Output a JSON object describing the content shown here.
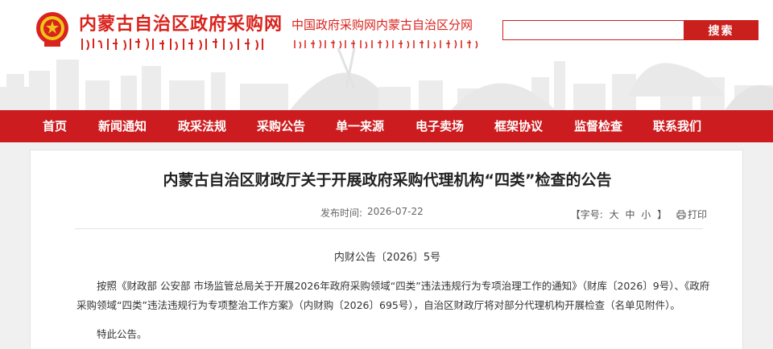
{
  "header": {
    "site_title": "内蒙古自治区政府采购网",
    "site_subtitle": "中国政府采购网内蒙古自治区分网",
    "search": {
      "value": "",
      "placeholder": "",
      "button_label": "搜索"
    }
  },
  "nav": {
    "items": [
      {
        "label": "首页"
      },
      {
        "label": "新闻通知"
      },
      {
        "label": "政采法规"
      },
      {
        "label": "采购公告"
      },
      {
        "label": "单一来源"
      },
      {
        "label": "电子卖场"
      },
      {
        "label": "框架协议"
      },
      {
        "label": "监督检查"
      },
      {
        "label": "联系我们"
      }
    ]
  },
  "article": {
    "title": "内蒙古自治区财政厅关于开展政府采购代理机构“四类”检查的公告",
    "publish_label": "发布时间:",
    "publish_date": "2026-07-22",
    "font_size_label": "【字号:",
    "size_large": "大",
    "size_medium": "中",
    "size_small": "小",
    "font_size_close": "】",
    "print_label": "打印",
    "doc_number": "内财公告〔2026〕5号",
    "body": "按照《财政部 公安部 市场监管总局关于开展2026年政府采购领域“四类”违法违规行为专项治理工作的通知》（财库〔2026〕9号）、《政府采购领域“四类”违法违规行为专项整治工作方案》（内财购〔2026〕695号），自治区财政厅将对部分代理机构开展检查（名单见附件）。",
    "closing": "特此公告。"
  },
  "colors": {
    "brand_red": "#cd1c1f",
    "title_red": "#d9231d"
  },
  "icons": {
    "emblem": "national-emblem-icon",
    "print": "printer-icon"
  }
}
